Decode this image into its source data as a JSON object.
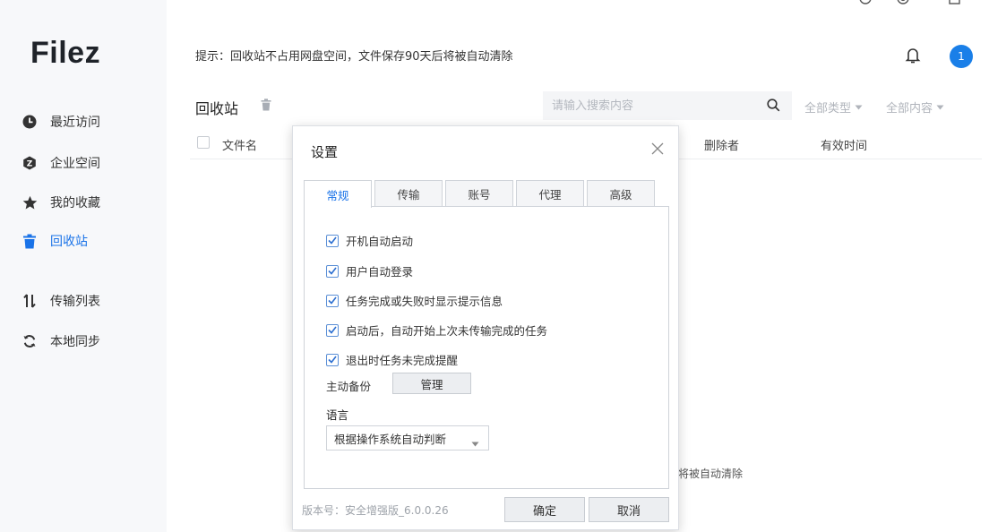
{
  "app": {
    "logo": "Filez"
  },
  "sidebar": {
    "items": [
      {
        "label": "最近访问",
        "icon": "clock-icon"
      },
      {
        "label": "企业空间",
        "icon": "enterprise-icon"
      },
      {
        "label": "我的收藏",
        "icon": "star-icon"
      },
      {
        "label": "回收站",
        "icon": "trash-icon",
        "active": true
      },
      {
        "label": "传输列表",
        "icon": "transfer-icon"
      },
      {
        "label": "本地同步",
        "icon": "sync-icon"
      }
    ]
  },
  "header": {
    "tip": "提示：回收站不占用网盘空间，文件保存90天后将被自动清除",
    "badge": "1",
    "page_title": "回收站",
    "search_placeholder": "请输入搜索内容",
    "filter_type": "全部类型",
    "filter_content": "全部内容"
  },
  "table": {
    "columns": [
      "文件名",
      "删除者",
      "有效时间"
    ]
  },
  "background_fragment": "将被自动清除",
  "dialog": {
    "title": "设置",
    "tabs": [
      "常规",
      "传输",
      "账号",
      "代理",
      "高级"
    ],
    "options": [
      "开机自动启动",
      "用户自动登录",
      "任务完成或失败时显示提示信息",
      "启动后，自动开始上次未传输完成的任务",
      "退出时任务未完成提醒"
    ],
    "backup_label": "主动备份",
    "manage_label": "管理",
    "language_label": "语言",
    "language_value": "根据操作系统自动判断",
    "version": "版本号：安全增强版_6.0.0.26",
    "ok_label": "确定",
    "cancel_label": "取消"
  },
  "colors": {
    "accent": "#1a73e8",
    "badge": "#1a7fe8"
  }
}
